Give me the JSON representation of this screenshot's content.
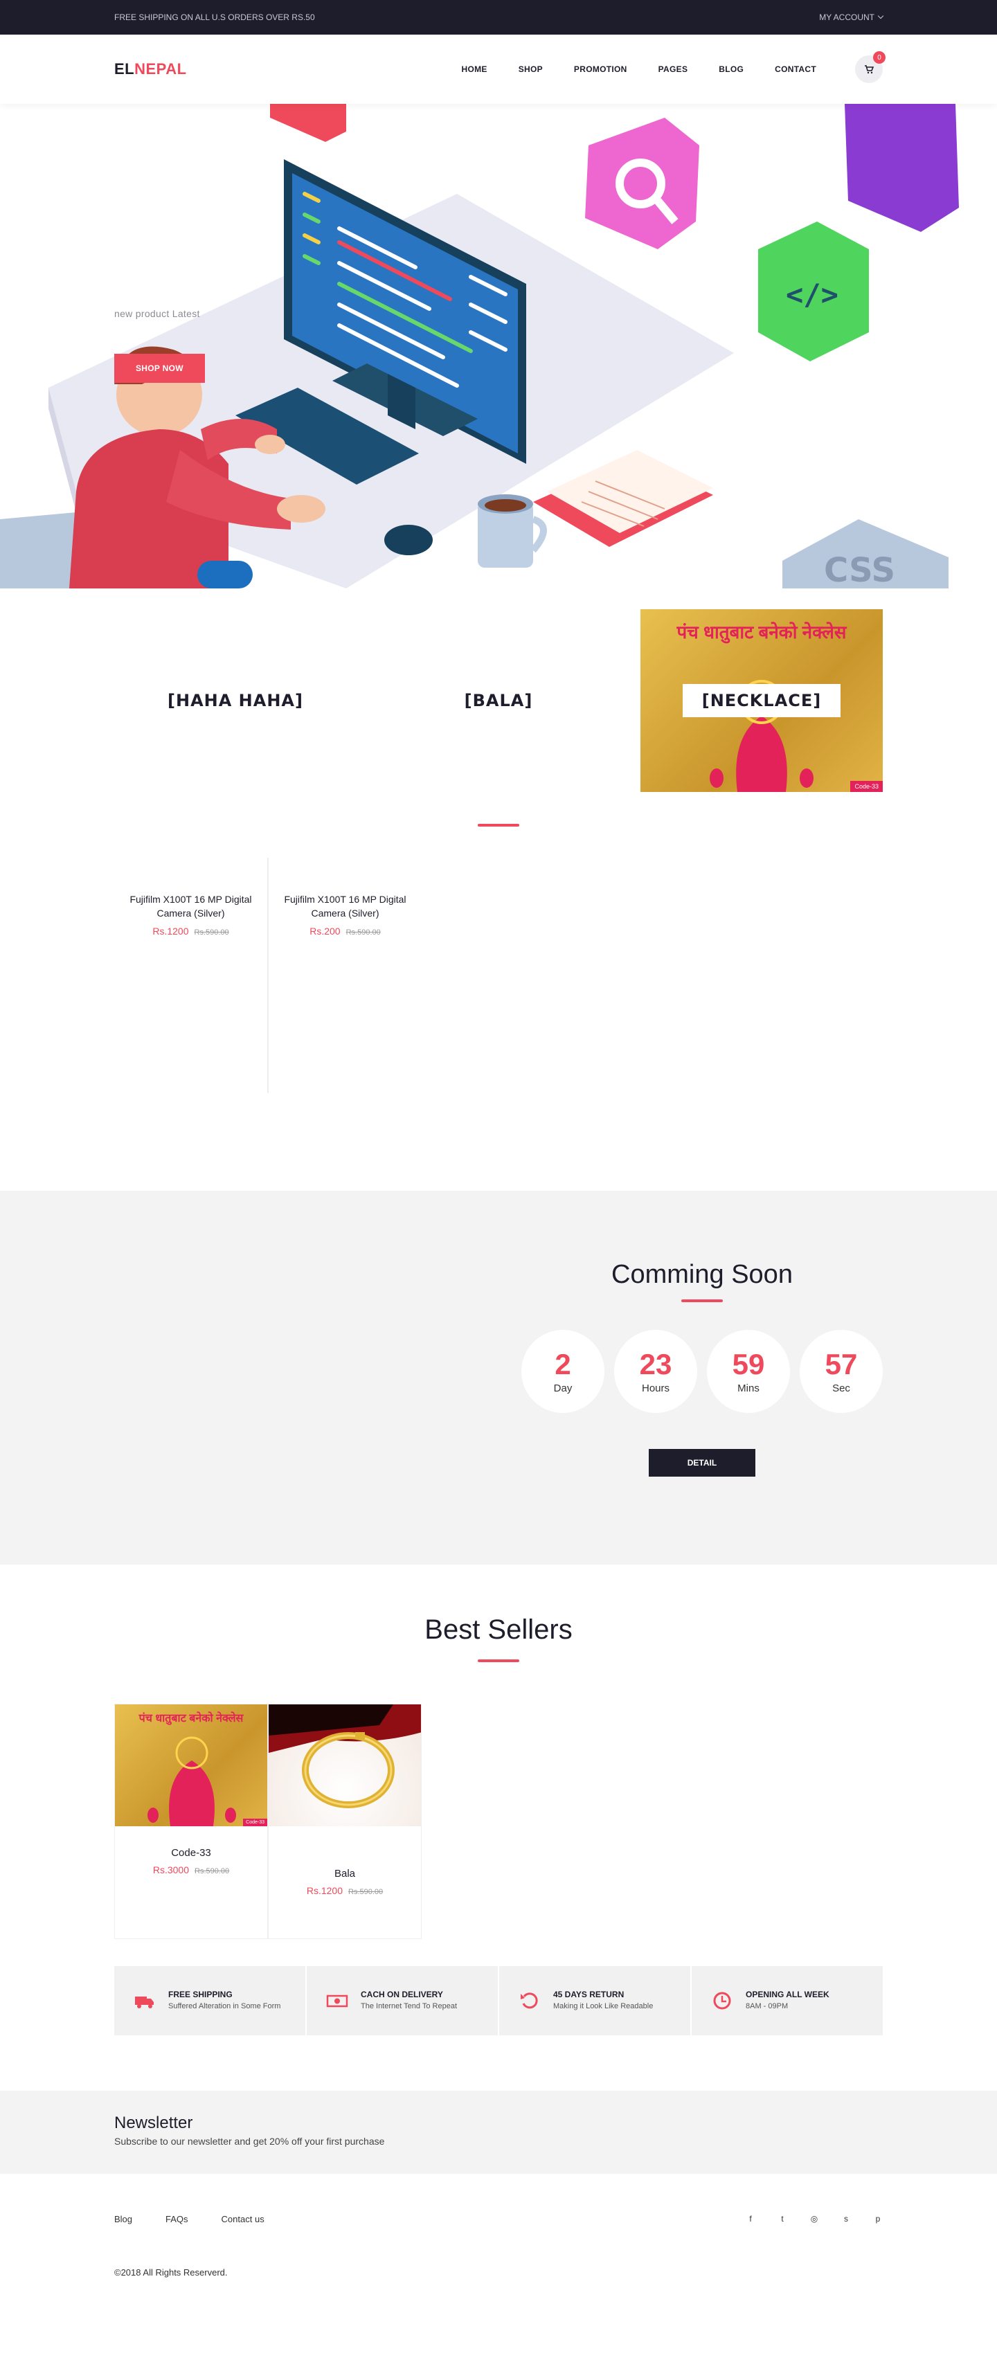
{
  "topbar": {
    "shipping_notice": "FREE SHIPPING ON ALL U.S ORDERS OVER RS.50",
    "account_label": "MY ACCOUNT"
  },
  "header": {
    "logo_part1": "EL",
    "logo_part2": "NEPAL",
    "nav": [
      "HOME",
      "SHOP",
      "PROMOTION",
      "PAGES",
      "BLOG",
      "CONTACT"
    ],
    "cart_count": "0"
  },
  "hero": {
    "subtitle": "new product Latest",
    "button": "SHOP NOW",
    "art": {
      "tile_html": "</>",
      "tile_css": "CSS"
    }
  },
  "categories": [
    {
      "label": "[HAHA HAHA]"
    },
    {
      "label": "[BALA]"
    },
    {
      "label": "[NECKLACE]",
      "image_text": "पंच धातुबाट बनेको नेक्लेस",
      "code": "Code-33"
    }
  ],
  "products": [
    {
      "name": "Fujifilm X100T 16 MP Digital Camera (Silver)",
      "price": "Rs.1200",
      "old_price": "Rs.590.00"
    },
    {
      "name": "Fujifilm X100T 16 MP Digital Camera (Silver)",
      "price": "Rs.200",
      "old_price": "Rs.590.00"
    }
  ],
  "coming_soon": {
    "title": "Comming Soon",
    "timers": [
      {
        "value": "2",
        "label": "Day"
      },
      {
        "value": "23",
        "label": "Hours"
      },
      {
        "value": "59",
        "label": "Mins"
      },
      {
        "value": "57",
        "label": "Sec"
      }
    ],
    "button": "DETAIL"
  },
  "best_sellers": {
    "title": "Best Sellers",
    "items": [
      {
        "name": "Code-33",
        "price": "Rs.3000",
        "old_price": "Rs.590.00",
        "image_text": "पंच धातुबाट बनेको नेक्लेस",
        "code": "Code-33"
      },
      {
        "name": "Bala",
        "price": "Rs.1200",
        "old_price": "Rs.590.00"
      }
    ]
  },
  "features": [
    {
      "icon": "truck-icon",
      "title": "FREE SHIPPING",
      "desc": "Suffered Alteration in Some Form"
    },
    {
      "icon": "cash-icon",
      "title": "CACH ON DELIVERY",
      "desc": "The Internet Tend To Repeat"
    },
    {
      "icon": "return-icon",
      "title": "45 DAYS RETURN",
      "desc": "Making it Look Like Readable"
    },
    {
      "icon": "clock-icon",
      "title": "OPENING ALL WEEK",
      "desc": "8AM - 09PM"
    }
  ],
  "newsletter": {
    "title": "Newsletter",
    "subtitle": "Subscribe to our newsletter and get 20% off your first purchase"
  },
  "footer": {
    "links": [
      "Blog",
      "FAQs",
      "Contact us"
    ],
    "social": [
      {
        "icon": "facebook-icon",
        "glyph": "f"
      },
      {
        "icon": "twitter-icon",
        "glyph": "t"
      },
      {
        "icon": "instagram-icon",
        "glyph": "◎"
      },
      {
        "icon": "skype-icon",
        "glyph": "s"
      },
      {
        "icon": "pinterest-icon",
        "glyph": "p"
      }
    ],
    "copyright": "©2018 All Rights Reserverd."
  },
  "colors": {
    "accent": "#ef4a5b",
    "dark": "#1d1d2b",
    "light_bg": "#f3f3f3"
  }
}
